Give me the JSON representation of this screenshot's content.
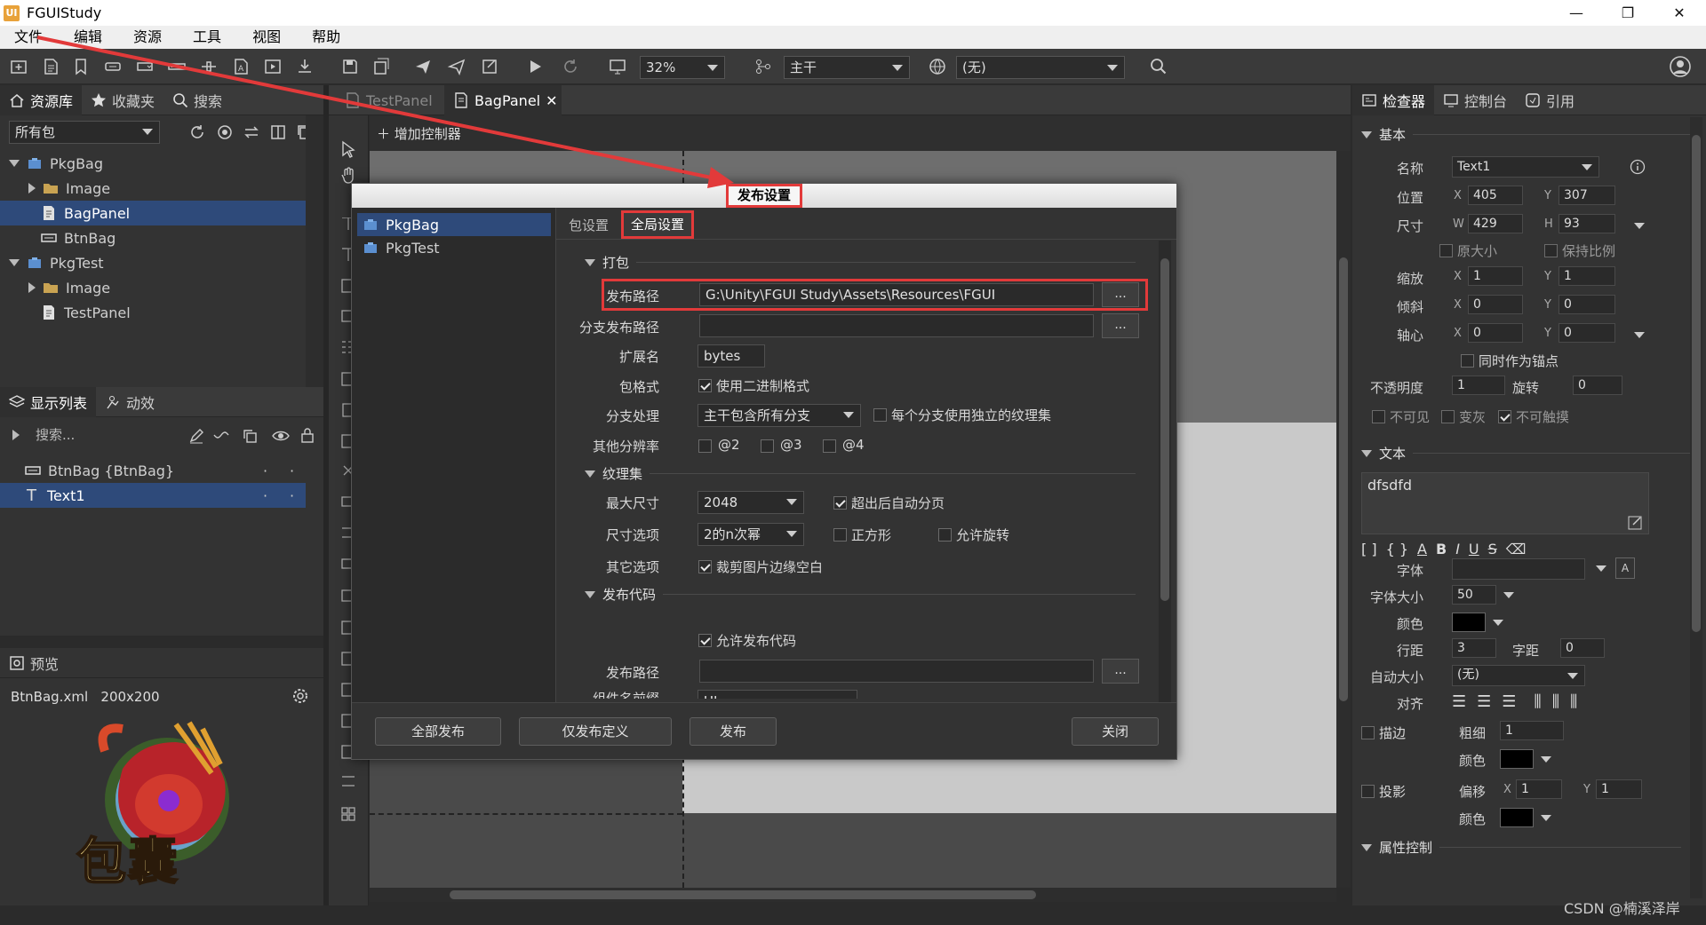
{
  "app": {
    "title": "FGUIStudy",
    "logo_text": "UI"
  },
  "window_controls": {
    "minimize": "—",
    "restore": "❐",
    "close": "✕"
  },
  "menu": [
    "文件",
    "编辑",
    "资源",
    "工具",
    "视图",
    "帮助"
  ],
  "toolbar": {
    "zoom": "32%",
    "branch": "主干",
    "language": "(无)"
  },
  "library": {
    "tabs": [
      "资源库",
      "收藏夹",
      "搜索"
    ],
    "package_filter": "所有包",
    "tree": [
      {
        "label": "PkgBag",
        "kind": "package",
        "expanded": true,
        "level": 0
      },
      {
        "label": "Image",
        "kind": "folder",
        "expanded": false,
        "level": 1
      },
      {
        "label": "BagPanel",
        "kind": "component",
        "level": 1,
        "selected": true
      },
      {
        "label": "BtnBag",
        "kind": "button",
        "level": 1
      },
      {
        "label": "PkgTest",
        "kind": "package",
        "expanded": true,
        "level": 0
      },
      {
        "label": "Image",
        "kind": "folder",
        "expanded": false,
        "level": 1
      },
      {
        "label": "TestPanel",
        "kind": "component",
        "level": 1
      }
    ]
  },
  "display_list": {
    "tabs": [
      "显示列表",
      "动效"
    ],
    "search_placeholder": "搜索...",
    "items": [
      {
        "label": "BtnBag {BtnBag}",
        "kind": "button"
      },
      {
        "label": "Text1",
        "kind": "text",
        "selected": true
      }
    ]
  },
  "preview": {
    "title": "预览",
    "info": "BtnBag.xml   200x200",
    "image_text": "包囊"
  },
  "doc_tabs": [
    {
      "label": "TestPanel",
      "active": false
    },
    {
      "label": "BagPanel",
      "active": true,
      "close": "✕"
    }
  ],
  "stage": {
    "add_controller": "增加控制器"
  },
  "publish_dialog": {
    "title": "发布设置",
    "packages": [
      "PkgBag",
      "PkgTest"
    ],
    "tabs": [
      "包设置",
      "全局设置"
    ],
    "sections": {
      "pack": "打包",
      "atlas": "纹理集",
      "code": "发布代码"
    },
    "labels": {
      "publish_path": "发布路径",
      "branch_path": "分支发布路径",
      "ext": "扩展名",
      "format": "包格式",
      "branch": "分支处理",
      "resolution": "其他分辨率",
      "max_size": "最大尺寸",
      "size_option": "尺寸选项",
      "other": "其它选项",
      "code_path": "发布路径",
      "code_prefix": "组件名前缀"
    },
    "values": {
      "publish_path": "G:\\Unity\\FGUI Study\\Assets\\Resources\\FGUI",
      "branch_path": "",
      "ext": "bytes",
      "format_check": "使用二进制格式",
      "branch_select": "主干包含所有分支",
      "branch_check": "每个分支使用独立的纹理集",
      "res2": "@2",
      "res3": "@3",
      "res4": "@4",
      "max_size": "2048",
      "auto_page": "超出后自动分页",
      "size_option": "2的n次幂",
      "square": "正方形",
      "rotate": "允许旋转",
      "trim": "裁剪图片边缘空白",
      "allow_code": "允许发布代码",
      "code_path": "",
      "code_prefix": "UI"
    },
    "browse": "...",
    "buttons": {
      "publish_all": "全部发布",
      "publish_def": "仅发布定义",
      "publish": "发布",
      "close": "关闭"
    }
  },
  "inspector": {
    "tabs": [
      "检查器",
      "控制台",
      "引用"
    ],
    "basic": "基本",
    "name_label": "名称",
    "name": "Text1",
    "pos_label": "位置",
    "x": "405",
    "y": "307",
    "size_label": "尺寸",
    "w": "429",
    "h": "93",
    "orig_size": "原大小",
    "keep_ratio": "保持比例",
    "scale_label": "缩放",
    "sx": "1",
    "sy": "1",
    "skew_label": "倾斜",
    "kx": "0",
    "ky": "0",
    "pivot_label": "轴心",
    "px": "0",
    "py": "0",
    "as_anchor": "同时作为锚点",
    "alpha_label": "不透明度",
    "alpha": "1",
    "rot_label": "旋转",
    "rot": "0",
    "invisible": "不可见",
    "grayed": "变灰",
    "untouchable": "不可触摸",
    "text_section": "文本",
    "text": "dfsdfd",
    "font_label": "字体",
    "font": "",
    "fontsize_label": "字体大小",
    "fontsize": "50",
    "color_label": "颜色",
    "color": "#000000",
    "leading_label": "行距",
    "leading": "3",
    "spacing_label": "字距",
    "spacing": "0",
    "autosize_label": "自动大小",
    "autosize": "(无)",
    "align_label": "对齐",
    "stroke_label": "描边",
    "stroke_thick_label": "粗细",
    "stroke_thick": "1",
    "stroke_color_label": "颜色",
    "shadow_label": "投影",
    "shadow_off_label": "偏移",
    "shadow_x": "1",
    "shadow_y": "1",
    "shadow_color_label": "颜色",
    "props_section": "属性控制",
    "axis_x": "X",
    "axis_y": "Y",
    "axis_w": "W",
    "axis_h": "H"
  },
  "watermark": "CSDN @楠溪泽岸",
  "colors": {
    "selection": "#2e4a7a",
    "highlight": "#e23a3a",
    "accent": "#3a7bd5"
  }
}
